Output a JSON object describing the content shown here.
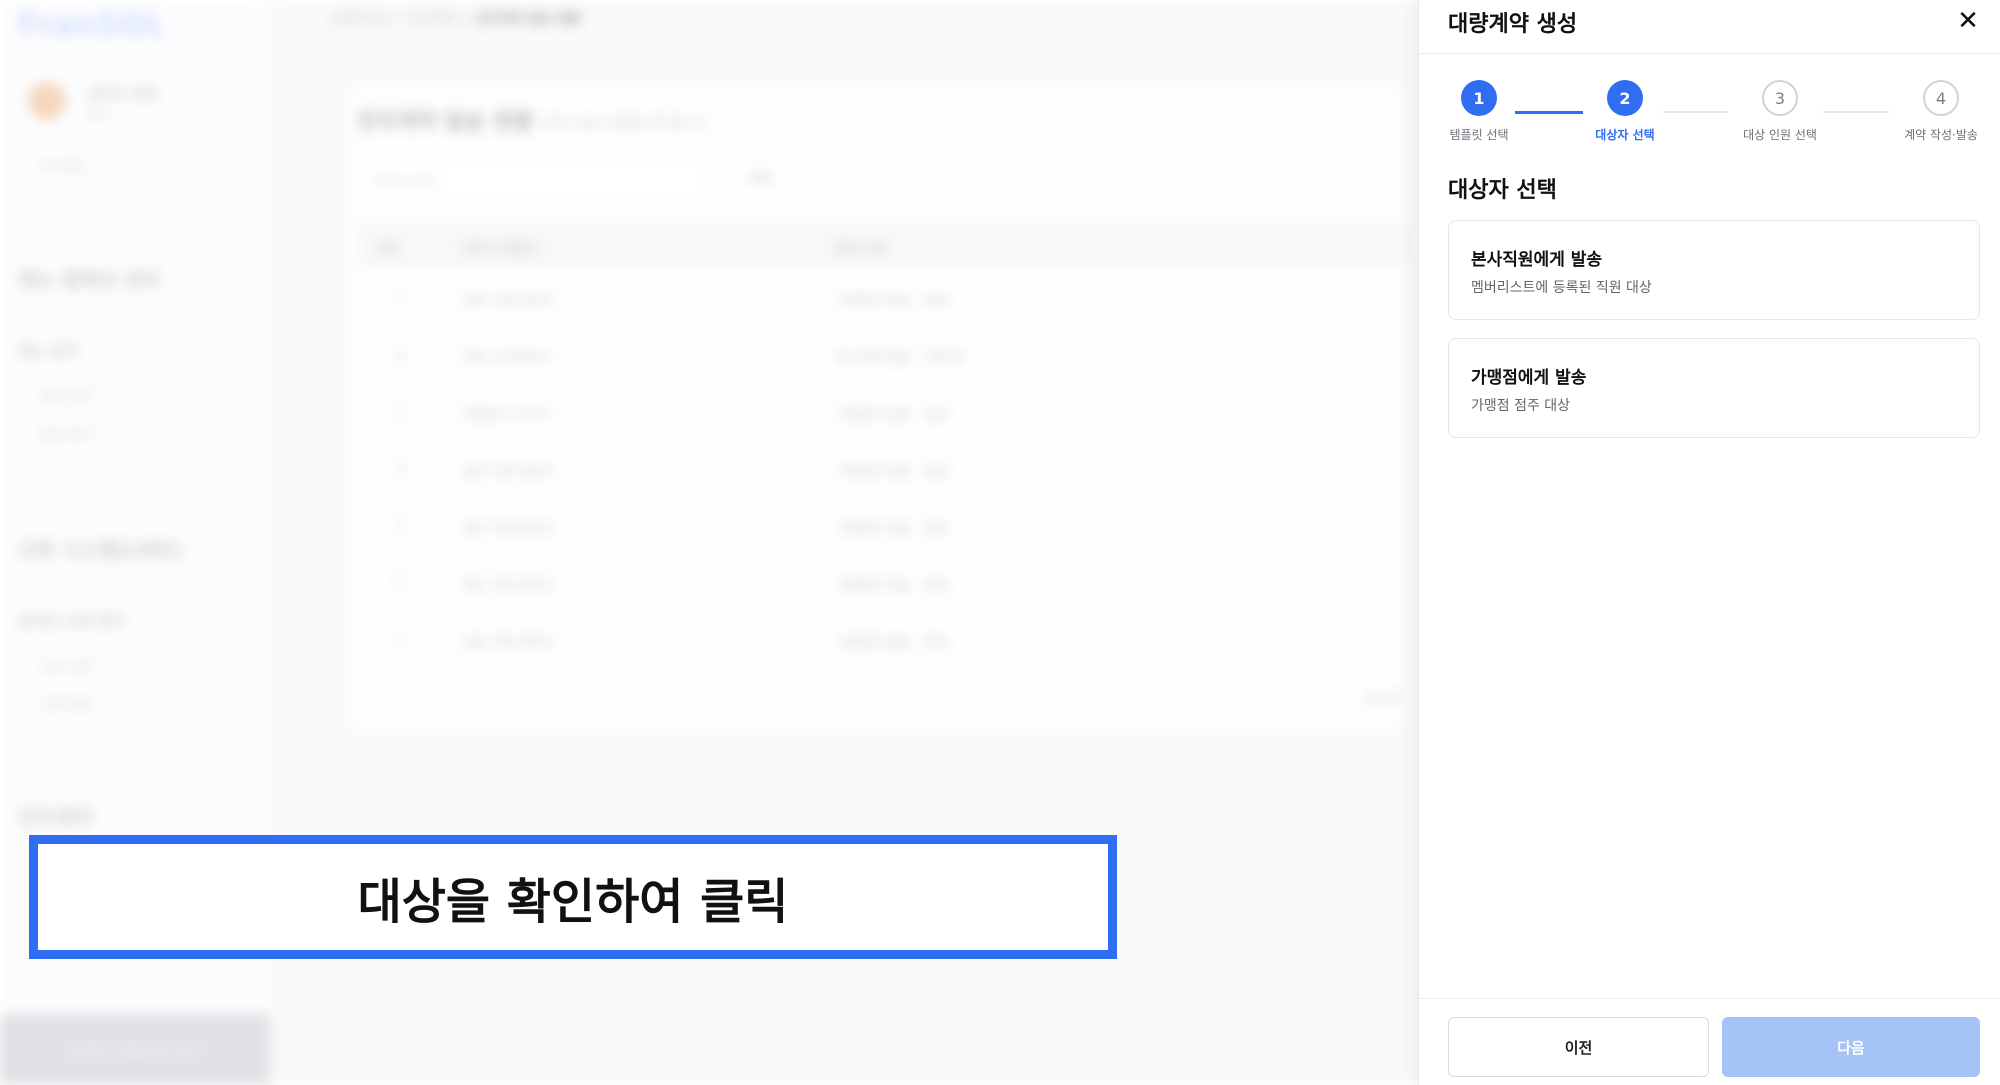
{
  "background": {
    "logo": "FranSOL",
    "user": {
      "name": "관리자 계정",
      "role": "본사"
    },
    "sidebar_link": "로그아웃",
    "sections": [
      {
        "title": "메뉴 컬렉션 관리",
        "group": "메뉴 관리",
        "items": [
          "메뉴 목록",
          "옵션 관리"
        ]
      },
      {
        "title": "교육 시스템(LMS)",
        "group": "온라인 교육 관리",
        "items": [
          "교육 과정",
          "교육 현황"
        ]
      },
      {
        "title": "전자계약",
        "group": "",
        "items": []
      }
    ],
    "bottom_button": "브랜드 매뉴얼 보기",
    "breadcrumb": [
      "프랜차이즈",
      "전자계약",
      "전자계약 발송 현황"
    ],
    "page_title": "전자계약 발송 현황",
    "page_subtitle": "계약서 발송 현황을 확인합니다",
    "search_placeholder": "계약서 검색",
    "search_button": "조회",
    "table": {
      "headers": [
        "번호",
        "계약서 템플릿",
        "발송 정보"
      ],
      "rows": [
        [
          "7",
          "표준 가맹 계약서",
          "가맹점주 발송 · 완료"
        ],
        [
          "6",
          "직원 근로계약서",
          "본사직원 발송 · 진행 중"
        ],
        [
          "5",
          "비밀유지 서약서",
          "가맹점주 발송 · 완료"
        ],
        [
          "4",
          "표준 가맹 계약서",
          "가맹점주 발송 · 완료"
        ],
        [
          "3",
          "표준 가맹 계약서",
          "가맹점주 발송 · 완료"
        ],
        [
          "2",
          "표준 가맹 계약서",
          "가맹점주 발송 · 완료"
        ],
        [
          "1",
          "표준 가맹 계약서",
          "가맹점주 발송 · 완료"
        ]
      ]
    },
    "pagination": "총 7건"
  },
  "callout": {
    "text": "대상을 확인하여 클릭"
  },
  "drawer": {
    "title": "대량계약 생성",
    "close_icon": "close-icon",
    "steps": [
      {
        "number": "1",
        "label": "템플릿 선택",
        "state": "done"
      },
      {
        "number": "2",
        "label": "대상자 선택",
        "state": "current"
      },
      {
        "number": "3",
        "label": "대상 인원 선택",
        "state": "todo"
      },
      {
        "number": "4",
        "label": "계약 작성·발송",
        "state": "todo"
      }
    ],
    "section_title": "대상자 선택",
    "options": [
      {
        "title": "본사직원에게 발송",
        "description": "멤버리스트에 등록된 직원 대상"
      },
      {
        "title": "가맹점에게 발송",
        "description": "가맹점 점주 대상"
      }
    ],
    "footer": {
      "prev_label": "이전",
      "next_label": "다음"
    }
  },
  "colors": {
    "accent": "#2f6ef2",
    "next_disabled": "#a6c3f7",
    "step_todo_border": "#cfd3d8"
  }
}
